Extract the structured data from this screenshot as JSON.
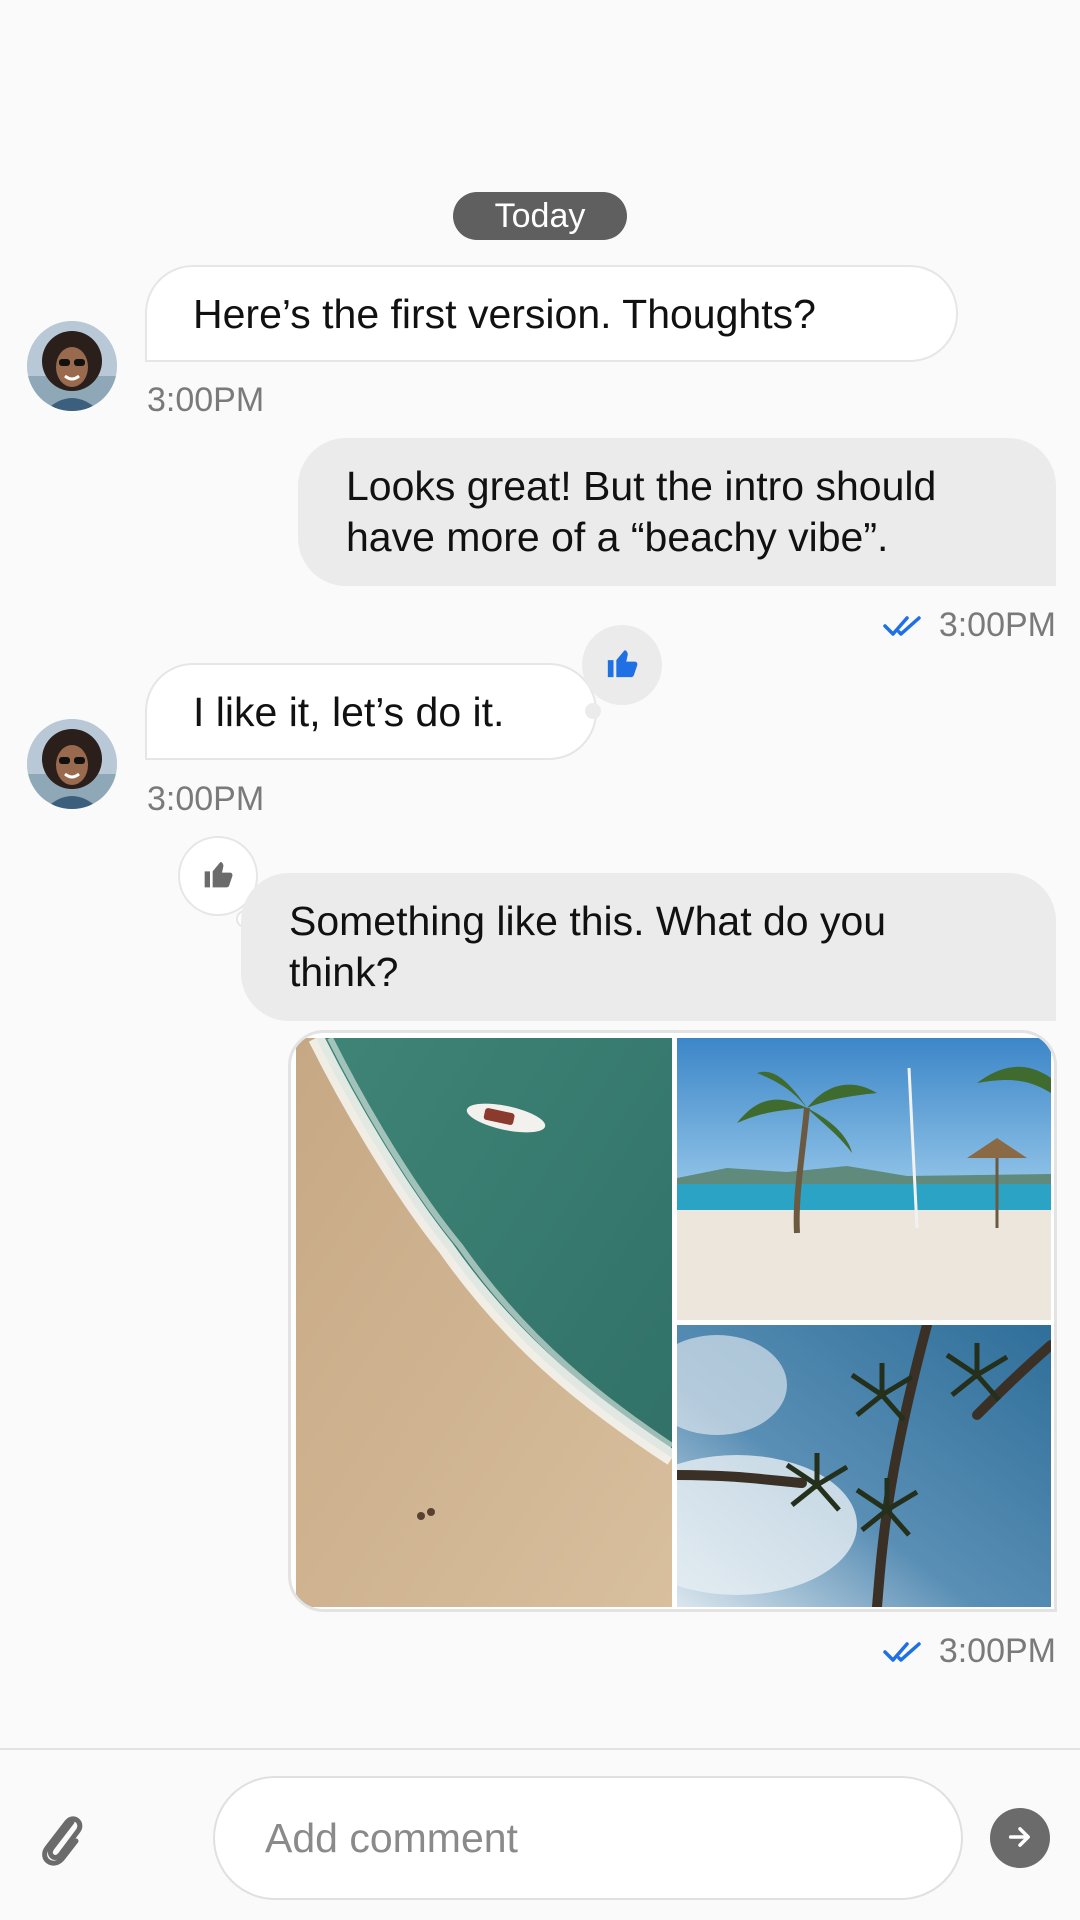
{
  "date_separator": "Today",
  "messages": [
    {
      "direction": "incoming",
      "text": "Here’s the first version. Thoughts?",
      "time": "3:00PM"
    },
    {
      "direction": "outgoing",
      "text": "Looks great! But the intro should have more of a “beachy vibe”.",
      "time": "3:00PM",
      "status": "read"
    },
    {
      "direction": "incoming",
      "text": "I like it, let’s do it.",
      "time": "3:00PM",
      "reaction": "thumbs-up",
      "reaction_color": "#1f6fe5"
    },
    {
      "direction": "outgoing",
      "text_line1": "Something like this. What do you",
      "text_line2": "think?",
      "reaction": "thumbs-up",
      "reaction_color": "#6b6b6b"
    },
    {
      "direction": "outgoing",
      "attachment": "image-grid",
      "images": [
        "aerial-beach-photo",
        "palm-beach-photo",
        "palm-trees-sky-photo"
      ],
      "time": "3:00PM",
      "status": "read"
    }
  ],
  "composer": {
    "placeholder": "Add comment",
    "attach_icon": "paperclip-icon",
    "send_icon": "arrow-right-icon"
  },
  "colors": {
    "accent_blue": "#1f6fe5",
    "bubble_outgoing": "#ebebeb",
    "bubble_incoming": "#ffffff",
    "date_pill": "#5f5f5f"
  }
}
